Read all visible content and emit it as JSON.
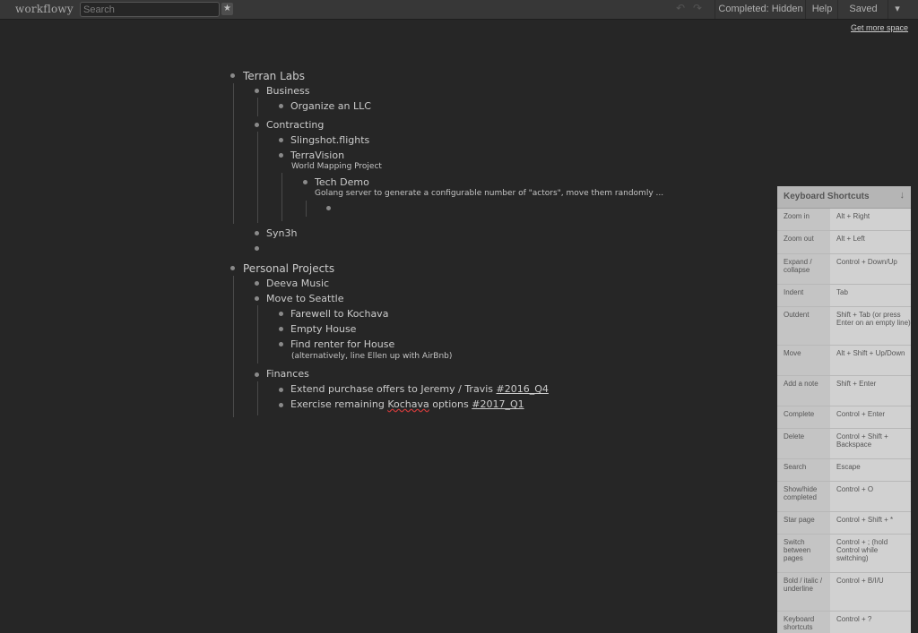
{
  "app": {
    "logo": "workflowy"
  },
  "toolbar": {
    "search_placeholder": "Search",
    "star_icon": "star-icon",
    "undo_icon": "undo-icon",
    "redo_icon": "redo-icon",
    "completed_label": "Completed: Hidden",
    "help_label": "Help",
    "saved_label": "Saved",
    "menu_icon": "▾"
  },
  "get_more_space": "Get more space",
  "outline": {
    "terran_labs": "Terran Labs",
    "business": "Business",
    "organize_llc": "Organize an LLC",
    "contracting": "Contracting",
    "slingshot": "Slingshot.flights",
    "terravision": "TerraVision",
    "terravision_note": "World Mapping Project",
    "tech_demo": "Tech Demo",
    "tech_demo_note": "Golang server to generate a configurable number of \"actors\", move them randomly ...",
    "syn3h": "Syn3h",
    "personal_projects": "Personal Projects",
    "deeva": "Deeva Music",
    "move_seattle": "Move to Seattle",
    "farewell_prefix": "Farewell to ",
    "farewell_word": "Kochava",
    "empty_house": "Empty House",
    "find_renter": "Find renter for House",
    "find_renter_note": "(alternatively, line Ellen up with AirBnb)",
    "finances": "Finances",
    "extend_text": "Extend purchase offers to Jeremy / Travis ",
    "extend_tag": "#2016_Q4",
    "exercise_prefix": "Exercise remaining ",
    "exercise_word": "Kochava",
    "exercise_mid": " options ",
    "exercise_tag": "#2017_Q1"
  },
  "shortcuts": {
    "title": "Keyboard Shortcuts",
    "close_icon": "↓",
    "rows": [
      {
        "action": "Zoom in",
        "keys": "Alt + Right"
      },
      {
        "action": "Zoom out",
        "keys": "Alt + Left"
      },
      {
        "action": "Expand / collapse",
        "keys": "Control + Down/Up"
      },
      {
        "action": "Indent",
        "keys": "Tab"
      },
      {
        "action": "Outdent",
        "keys": "Shift + Tab (or press Enter on an empty line)"
      },
      {
        "action": "Move",
        "keys": "Alt + Shift + Up/Down"
      },
      {
        "action": "Add a note",
        "keys": "Shift + Enter"
      },
      {
        "action": "Complete",
        "keys": "Control + Enter"
      },
      {
        "action": "Delete",
        "keys": "Control + Shift + Backspace"
      },
      {
        "action": "Search",
        "keys": "Escape"
      },
      {
        "action": "Show/hide completed",
        "keys": "Control + O"
      },
      {
        "action": "Star page",
        "keys": "Control + Shift + *"
      },
      {
        "action": "Switch between pages",
        "keys": "Control + ; (hold Control while switching)"
      },
      {
        "action": "Bold / italic / underline",
        "keys": "Control + B/I/U"
      },
      {
        "action": "Keyboard shortcuts",
        "keys": "Control + ?"
      }
    ]
  }
}
